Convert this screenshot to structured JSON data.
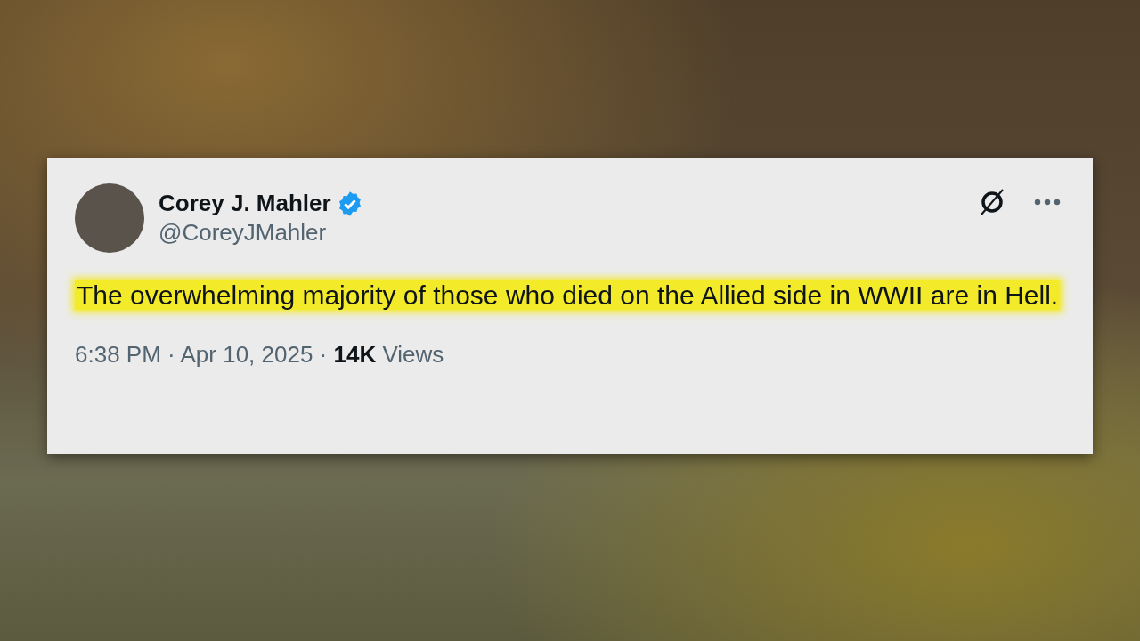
{
  "post": {
    "author": {
      "name": "Corey J. Mahler",
      "handle": "@CoreyJMahler",
      "verified": true
    },
    "text": "The overwhelming majority of those who died on the Allied side in WWII are in Hell.",
    "highlighted": true,
    "meta": "6:38 PM · Apr 10, 2025 · **14K** Views"
  }
}
